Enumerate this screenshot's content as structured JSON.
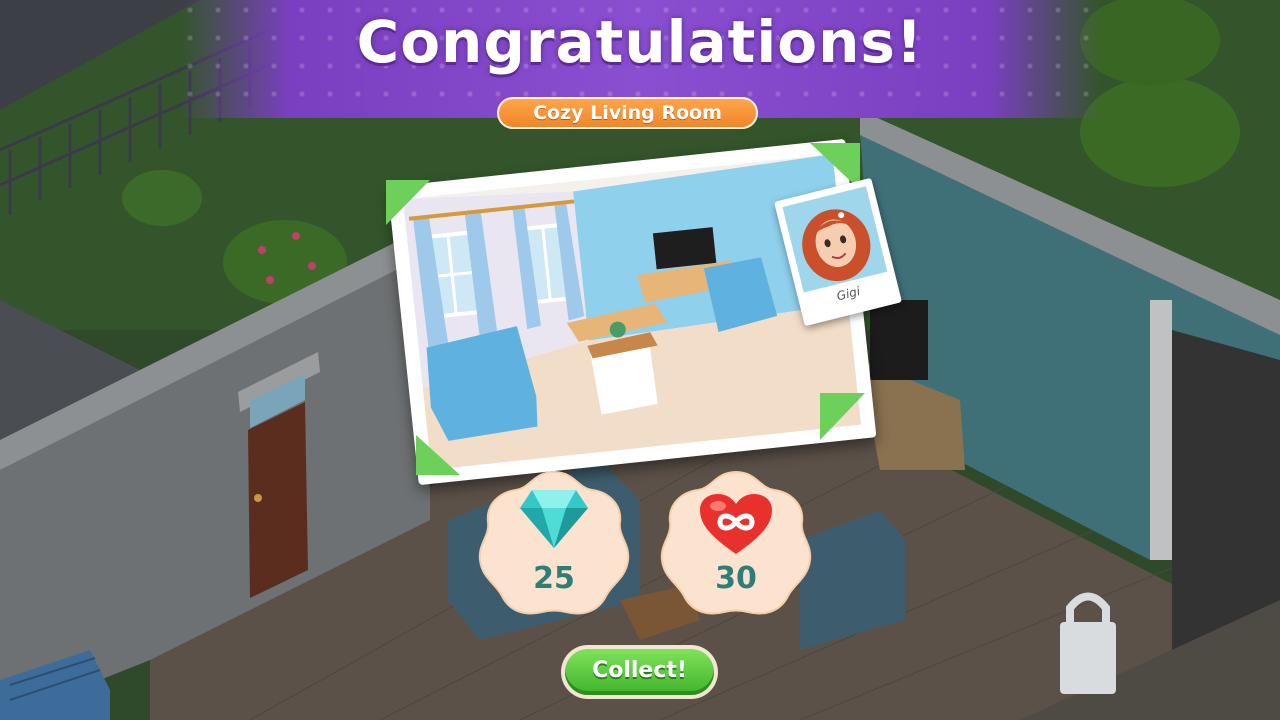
{
  "banner": {
    "title": "Congratulations!",
    "room_name": "Cozy Living Room"
  },
  "polaroid": {
    "name": "Gigi"
  },
  "rewards": [
    {
      "icon": "diamond-icon",
      "count": "25"
    },
    {
      "icon": "infinite-heart-icon",
      "count": "30"
    }
  ],
  "collect_button": {
    "label": "Collect!"
  },
  "colors": {
    "banner": "#8a4fd0",
    "pill": "#f0862a",
    "button": "#3fb32a",
    "count_text": "#2e7e78"
  }
}
